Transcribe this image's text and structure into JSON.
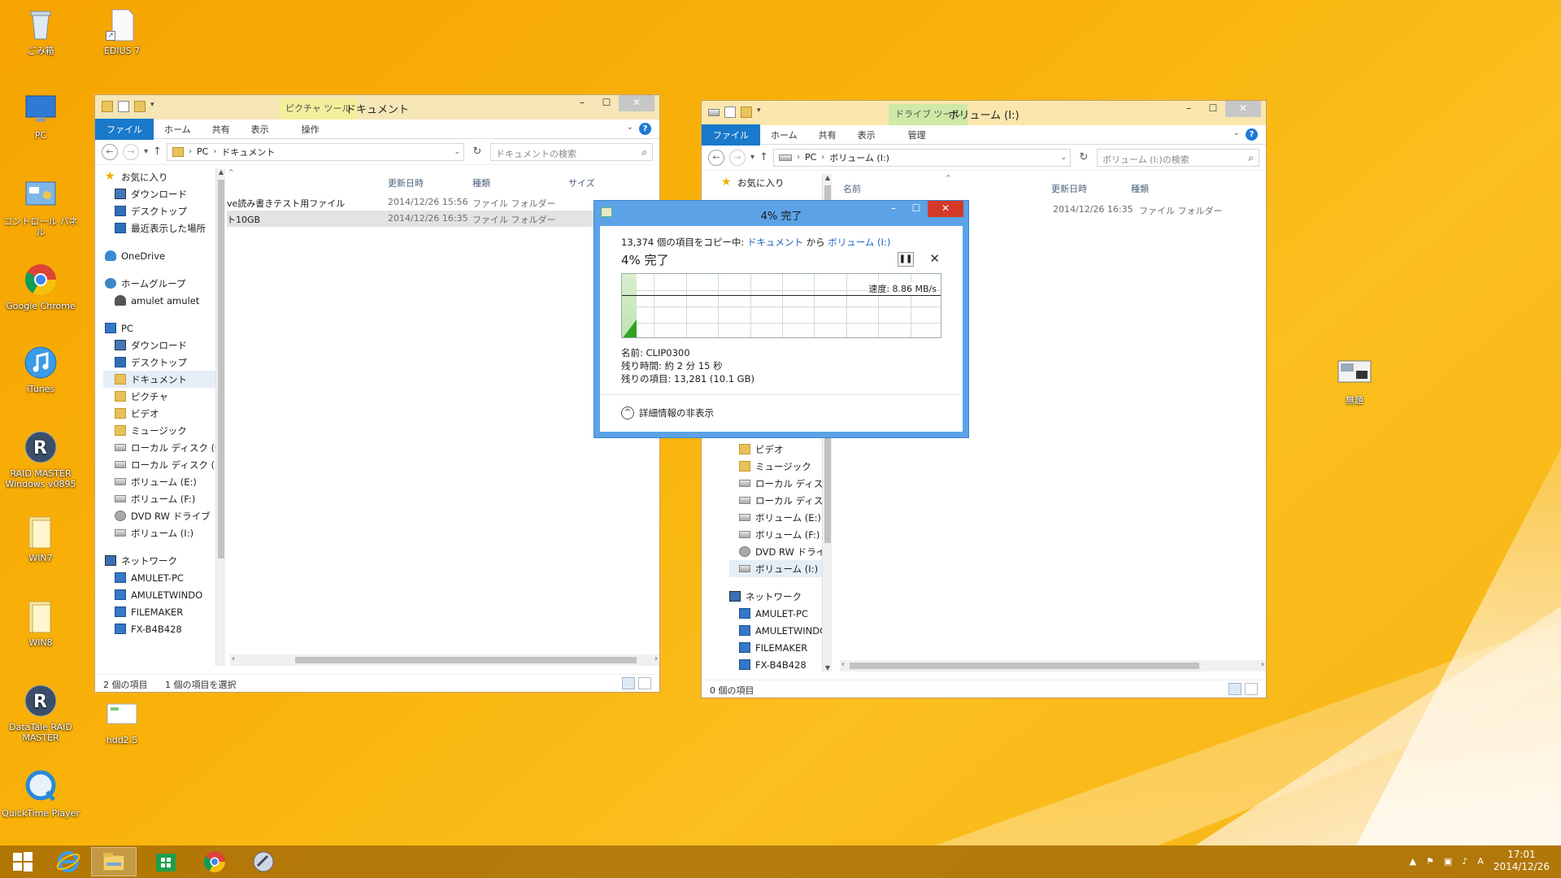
{
  "desktop": {
    "icons": [
      {
        "label": "ごみ箱"
      },
      {
        "label": "EDIUS 7"
      },
      {
        "label": "PC"
      },
      {
        "label": "コントロール パネル"
      },
      {
        "label": "Google Chrome"
      },
      {
        "label": "iTunes"
      },
      {
        "label": "RAID MASTER Windows v0895"
      },
      {
        "label": "WIN7"
      },
      {
        "label": "WIN8"
      },
      {
        "label": "DataTale RAID MASTER"
      },
      {
        "label": "hdd2.5"
      },
      {
        "label": "QuickTime Player"
      },
      {
        "label": "無題"
      }
    ]
  },
  "left_window": {
    "title": "ドキュメント",
    "context_tab": "ピクチャ ツール",
    "ribbon_tabs": [
      "ファイル",
      "ホーム",
      "共有",
      "表示",
      "操作"
    ],
    "address": [
      "PC",
      "ドキュメント"
    ],
    "search_placeholder": "ドキュメントの検索",
    "columns": [
      "更新日時",
      "種類",
      "サイズ"
    ],
    "files": [
      {
        "name": "ve読み書きテスト用ファイル",
        "date": "2014/12/26 15:56",
        "type": "ファイル フォルダー"
      },
      {
        "name": "ト10GB",
        "date": "2014/12/26 16:35",
        "type": "ファイル フォルダー"
      }
    ],
    "tree": [
      {
        "label": "お気に入り",
        "icon": "star-icon"
      },
      {
        "label": "ダウンロード",
        "icon": "download-folder-icon"
      },
      {
        "label": "デスクトップ",
        "icon": "desktop-icon"
      },
      {
        "label": "最近表示した場所",
        "icon": "recent-places-icon"
      },
      {
        "label": "OneDrive",
        "icon": "cloud-icon"
      },
      {
        "label": "ホームグループ",
        "icon": "homegroup-icon"
      },
      {
        "label": "amulet amulet",
        "icon": "user-icon"
      },
      {
        "label": "PC",
        "icon": "pc-icon"
      },
      {
        "label": "ダウンロード",
        "icon": "download-folder-icon"
      },
      {
        "label": "デスクトップ",
        "icon": "desktop-icon"
      },
      {
        "label": "ドキュメント",
        "icon": "folder-icon"
      },
      {
        "label": "ピクチャ",
        "icon": "folder-icon"
      },
      {
        "label": "ビデオ",
        "icon": "folder-icon"
      },
      {
        "label": "ミュージック",
        "icon": "folder-icon"
      },
      {
        "label": "ローカル ディスク (C",
        "icon": "disk-icon"
      },
      {
        "label": "ローカル ディスク (D",
        "icon": "drive-icon"
      },
      {
        "label": "ボリューム (E:)",
        "icon": "drive-icon"
      },
      {
        "label": "ボリューム (F:)",
        "icon": "drive-icon"
      },
      {
        "label": "DVD RW ドライブ",
        "icon": "disc-icon"
      },
      {
        "label": "ボリューム (I:)",
        "icon": "drive-icon"
      },
      {
        "label": "ネットワーク",
        "icon": "network-icon"
      },
      {
        "label": "AMULET-PC",
        "icon": "computer-icon"
      },
      {
        "label": "AMULETWINDO",
        "icon": "computer-icon"
      },
      {
        "label": "FILEMAKER",
        "icon": "computer-icon"
      },
      {
        "label": "FX-B4B428",
        "icon": "computer-icon"
      }
    ],
    "status_items": "2 個の項目",
    "status_selected": "1 個の項目を選択"
  },
  "right_window": {
    "title": "ボリューム (I:)",
    "context_tab": "ドライブ ツール",
    "ribbon_tabs": [
      "ファイル",
      "ホーム",
      "共有",
      "表示",
      "管理"
    ],
    "address": [
      "PC",
      "ボリューム (I:)"
    ],
    "search_placeholder": "ボリューム (I:)の検索",
    "columns": [
      "名前",
      "更新日時",
      "種類"
    ],
    "files": [
      {
        "name": "",
        "date": "2014/12/26 16:35",
        "type": "ファイル フォルダー"
      }
    ],
    "tree_top": [
      {
        "label": "お気に入り"
      }
    ],
    "tree": [
      {
        "label": "ビデオ"
      },
      {
        "label": "ミュージック"
      },
      {
        "label": "ローカル ディスク (C"
      },
      {
        "label": "ローカル ディスク (D"
      },
      {
        "label": "ボリューム (E:)"
      },
      {
        "label": "ボリューム (F:)"
      },
      {
        "label": "DVD RW ドライブ"
      },
      {
        "label": "ボリューム (I:)"
      },
      {
        "label": "ネットワーク"
      },
      {
        "label": "AMULET-PC"
      },
      {
        "label": "AMULETWINDC"
      },
      {
        "label": "FILEMAKER"
      },
      {
        "label": "FX-B4B428"
      }
    ],
    "status_items": "0 個の項目"
  },
  "copy_dialog": {
    "title": "4% 完了",
    "line_prefix": "13,374 個の項目をコピー中: ",
    "source": "ドキュメント",
    "from_word": " から ",
    "dest": "ボリューム (I:)",
    "percent_text": "4% 完了",
    "progress_fraction": 0.04,
    "speed_label": "速度: 8.86 MB/s",
    "name_line": "名前: CLIP0300",
    "time_line": "残り時間: 約 2 分 15 秒",
    "items_line": "残りの項目: 13,281 (10.1 GB)",
    "details_toggle": "詳細情報の非表示"
  },
  "taskbar": {
    "clock_time": "17:01",
    "clock_date": "2014/12/26",
    "ime": "A"
  }
}
